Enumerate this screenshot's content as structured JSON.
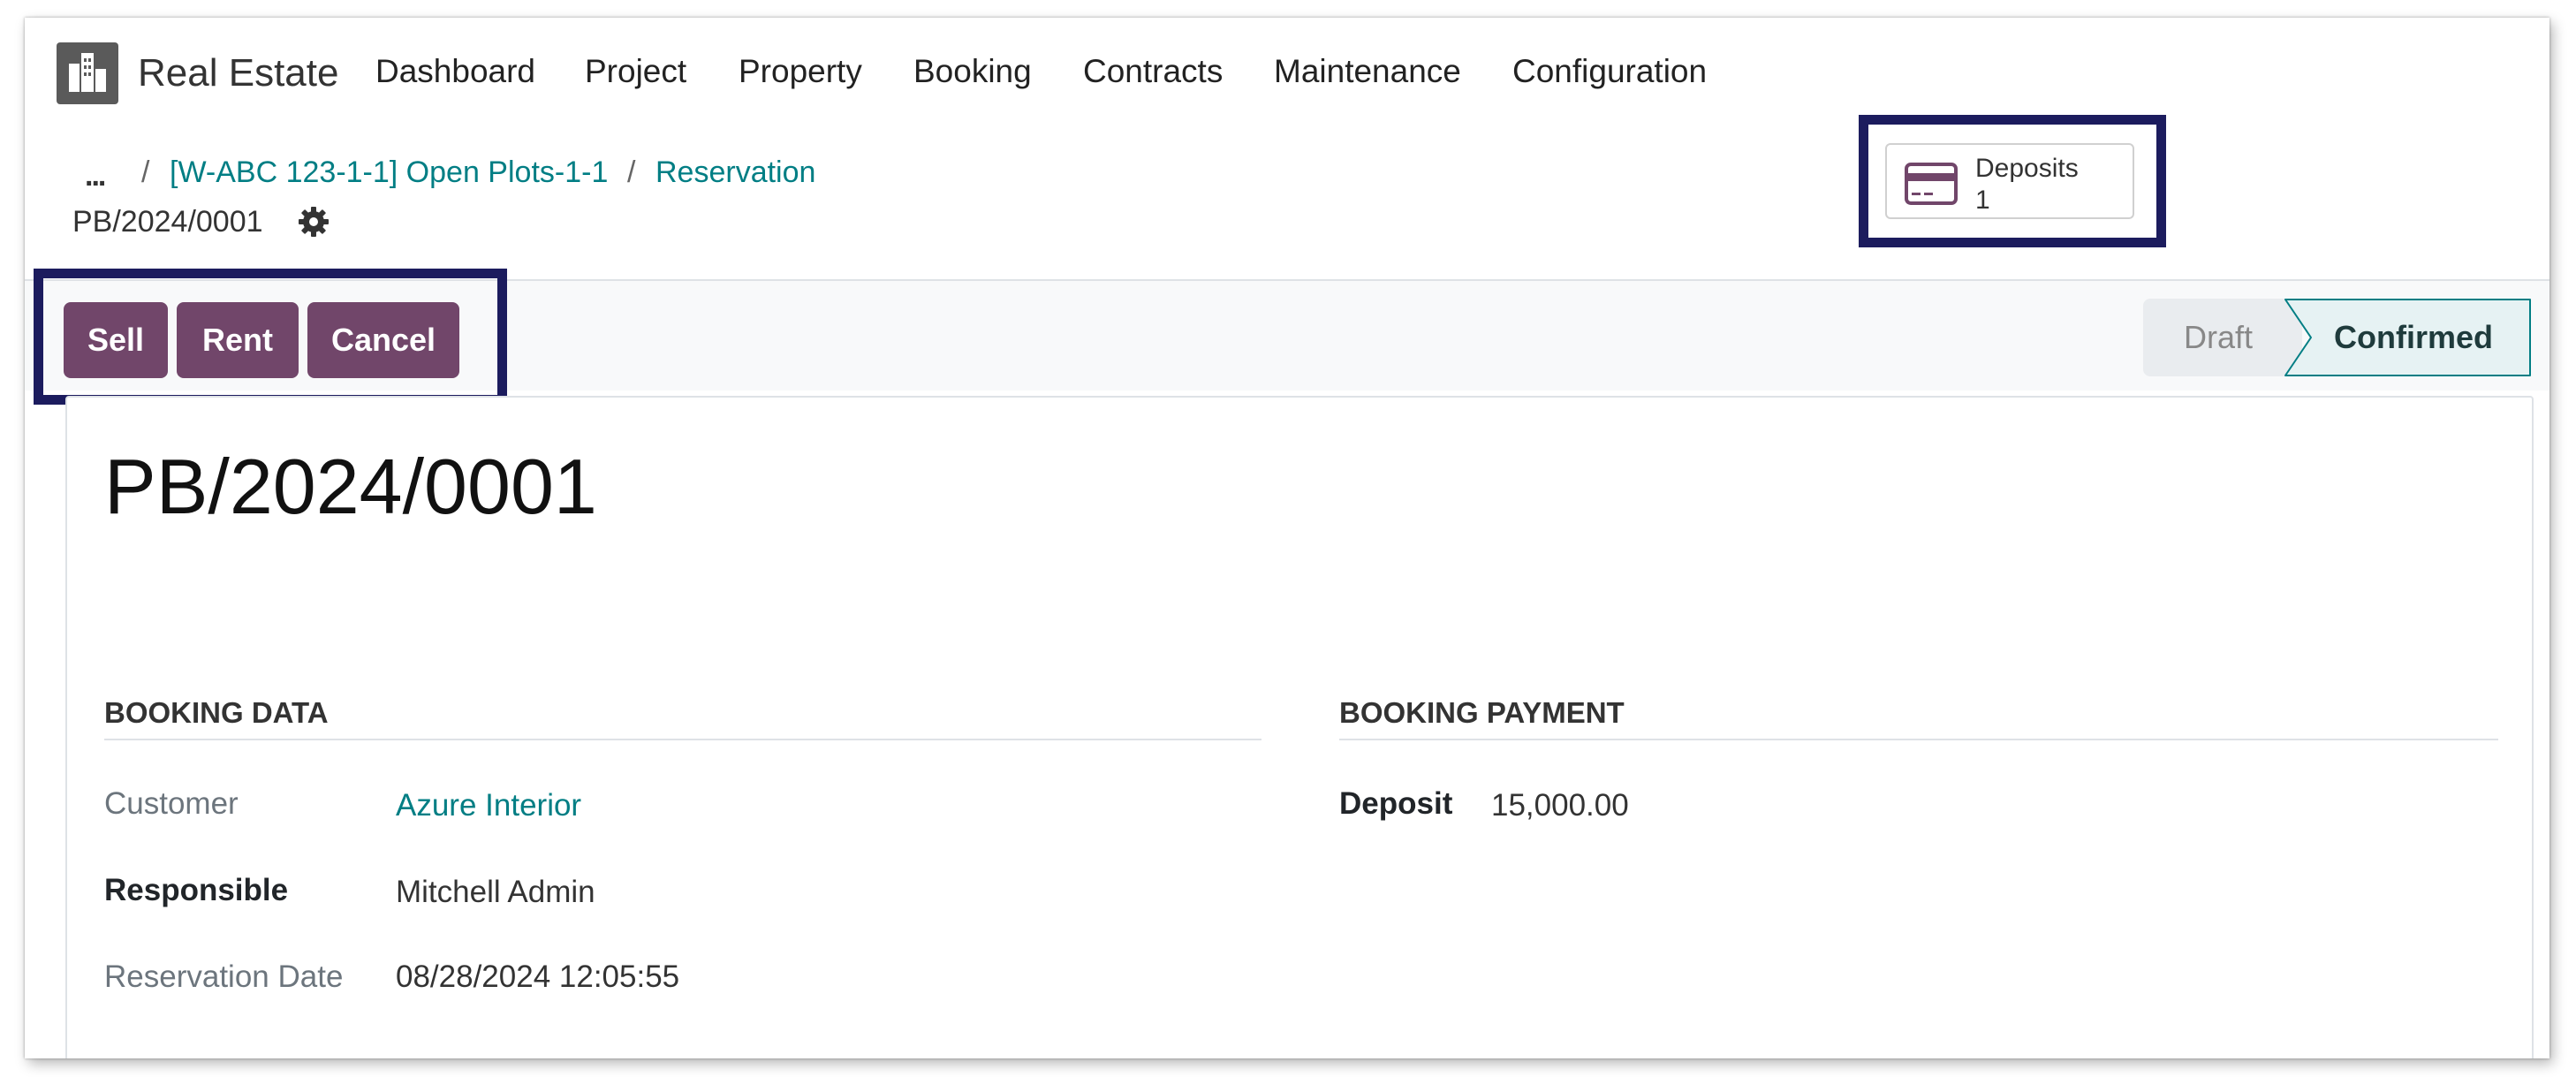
{
  "app": {
    "name": "Real Estate",
    "menu": [
      "Dashboard",
      "Project",
      "Property",
      "Booking",
      "Contracts",
      "Maintenance",
      "Configuration"
    ]
  },
  "breadcrumb": {
    "ellipsis": "...",
    "separator": "/",
    "items": [
      "[W-ABC 123-1-1] Open Plots-1-1",
      "Reservation"
    ],
    "current": "PB/2024/0001"
  },
  "smart_buttons": {
    "deposits": {
      "label": "Deposits",
      "count": "1",
      "icon": "credit-card-icon"
    }
  },
  "actions": {
    "sell": "Sell",
    "rent": "Rent",
    "cancel": "Cancel"
  },
  "status": {
    "stages": [
      "Draft",
      "Confirmed"
    ],
    "current": "Confirmed"
  },
  "record": {
    "title": "PB/2024/0001"
  },
  "booking_data": {
    "title": "BOOKING DATA",
    "customer_label": "Customer",
    "customer": "Azure Interior",
    "responsible_label": "Responsible",
    "responsible": "Mitchell Admin",
    "reservation_date_label": "Reservation Date",
    "reservation_date": "08/28/2024 12:05:55"
  },
  "booking_payment": {
    "title": "BOOKING PAYMENT",
    "deposit_label": "Deposit",
    "deposit": "15,000.00"
  },
  "colors": {
    "primary": "#71466a",
    "link": "#017e84",
    "highlight_border": "#1c1c5e"
  }
}
